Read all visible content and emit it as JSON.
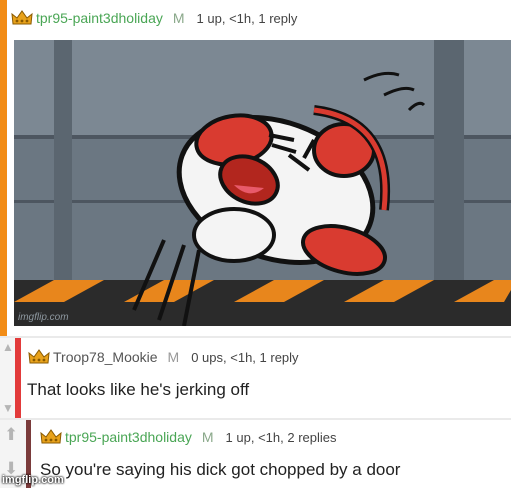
{
  "comments": [
    {
      "username": "tpr95-paint3dholiday",
      "badge": "M",
      "meta": "1 up, <1h, 1 reply",
      "image_alt": "Cartoon character with headphones tilted back shouting",
      "image_watermark": "imgflip.com"
    },
    {
      "username": "Troop78_Mookie",
      "badge": "M",
      "meta": "0 ups, <1h, 1 reply",
      "text": "That looks like he's jerking off"
    },
    {
      "username": "tpr95-paint3dholiday",
      "badge": "M",
      "meta": "1 up, <1h, 2 replies",
      "text": "So you're saying his dick got chopped by a door"
    }
  ],
  "site_watermark": "imgflip.com",
  "colors": {
    "accent_orange": "#f28c16",
    "depth_red": "#e23a3a",
    "username_green": "#4aa655"
  }
}
